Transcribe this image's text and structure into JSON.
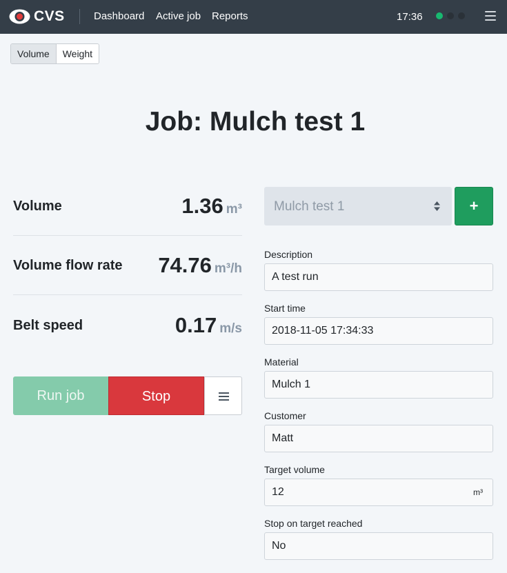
{
  "navbar": {
    "brand": "CVS",
    "links": [
      "Dashboard",
      "Active job",
      "Reports"
    ],
    "time": "17:36",
    "status_dots": [
      "#18b870",
      "#2a3138",
      "#2a3138"
    ]
  },
  "mode_toggle": {
    "options": [
      "Volume",
      "Weight"
    ],
    "selected": "Volume"
  },
  "title": "Job: Mulch test 1",
  "metrics": [
    {
      "label": "Volume",
      "value": "1.36",
      "unit": "m³"
    },
    {
      "label": "Volume flow rate",
      "value": "74.76",
      "unit": "m³/h"
    },
    {
      "label": "Belt speed",
      "value": "0.17",
      "unit": "m/s"
    }
  ],
  "actions": {
    "run": "Run job",
    "stop": "Stop"
  },
  "job_select": {
    "value": "Mulch test 1",
    "add": "+"
  },
  "fields": [
    {
      "label": "Description",
      "value": "A test run",
      "unit": ""
    },
    {
      "label": "Start time",
      "value": "2018-11-05 17:34:33",
      "unit": ""
    },
    {
      "label": "Material",
      "value": "Mulch 1",
      "unit": ""
    },
    {
      "label": "Customer",
      "value": "Matt",
      "unit": ""
    },
    {
      "label": "Target volume",
      "value": "12",
      "unit": "m³"
    },
    {
      "label": "Stop on target reached",
      "value": "No",
      "unit": ""
    }
  ],
  "colors": {
    "navbar": "#343e48",
    "run": "#84cbab",
    "stop": "#d9383d",
    "add": "#1f9d5e"
  }
}
